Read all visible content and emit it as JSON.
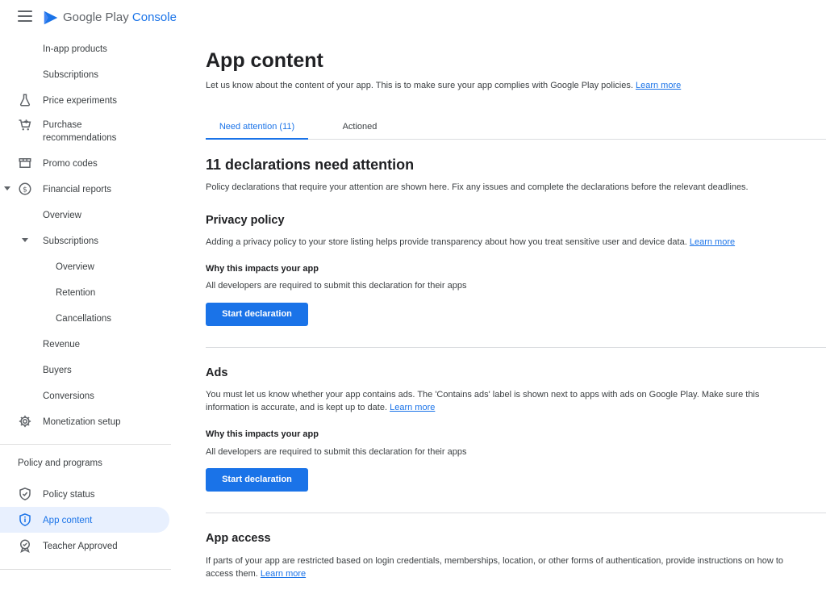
{
  "brand": {
    "name": "Google Play",
    "product": "Console"
  },
  "sidebar": {
    "items": [
      {
        "label": "In-app products"
      },
      {
        "label": "Subscriptions"
      },
      {
        "label": "Price experiments"
      },
      {
        "label": "Purchase recommendations"
      },
      {
        "label": "Promo codes"
      },
      {
        "label": "Financial reports"
      },
      {
        "label": "Overview"
      },
      {
        "label": "Subscriptions"
      },
      {
        "label": "Overview"
      },
      {
        "label": "Retention"
      },
      {
        "label": "Cancellations"
      },
      {
        "label": "Revenue"
      },
      {
        "label": "Buyers"
      },
      {
        "label": "Conversions"
      },
      {
        "label": "Monetization setup"
      }
    ],
    "section_title": "Policy and programs",
    "policy_items": [
      {
        "label": "Policy status"
      },
      {
        "label": "App content",
        "active": true
      },
      {
        "label": "Teacher Approved"
      }
    ]
  },
  "main": {
    "title": "App content",
    "description": "Let us know about the content of your app. This is to make sure your app complies with Google Play policies.",
    "learn_more": "Learn more",
    "tabs": [
      {
        "label": "Need attention (11)",
        "active": true
      },
      {
        "label": "Actioned"
      }
    ],
    "declarations_title": "11 declarations need attention",
    "declarations_desc": "Policy declarations that require your attention are shown here. Fix any issues and complete the declarations before the relevant deadlines.",
    "sections": [
      {
        "title": "Privacy policy",
        "desc": "Adding a privacy policy to your store listing helps provide transparency about how you treat sensitive user and device data.",
        "learn_more": "Learn more",
        "why_title": "Why this impacts your app",
        "why_desc": "All developers are required to submit this declaration for their apps",
        "button": "Start declaration"
      },
      {
        "title": "Ads",
        "desc": "You must let us know whether your app contains ads. The 'Contains ads' label is shown next to apps with ads on Google Play. Make sure this information is accurate, and is kept up to date.",
        "learn_more": "Learn more",
        "why_title": "Why this impacts your app",
        "why_desc": "All developers are required to submit this declaration for their apps",
        "button": "Start declaration"
      },
      {
        "title": "App access",
        "desc": "If parts of your app are restricted based on login credentials, memberships, location, or other forms of authentication, provide instructions on how to access them.",
        "learn_more": "Learn more"
      }
    ]
  },
  "colors": {
    "accent": "#1a73e8",
    "active_bg": "#e8f0fe",
    "text": "#202124",
    "secondary": "#3c4043"
  }
}
